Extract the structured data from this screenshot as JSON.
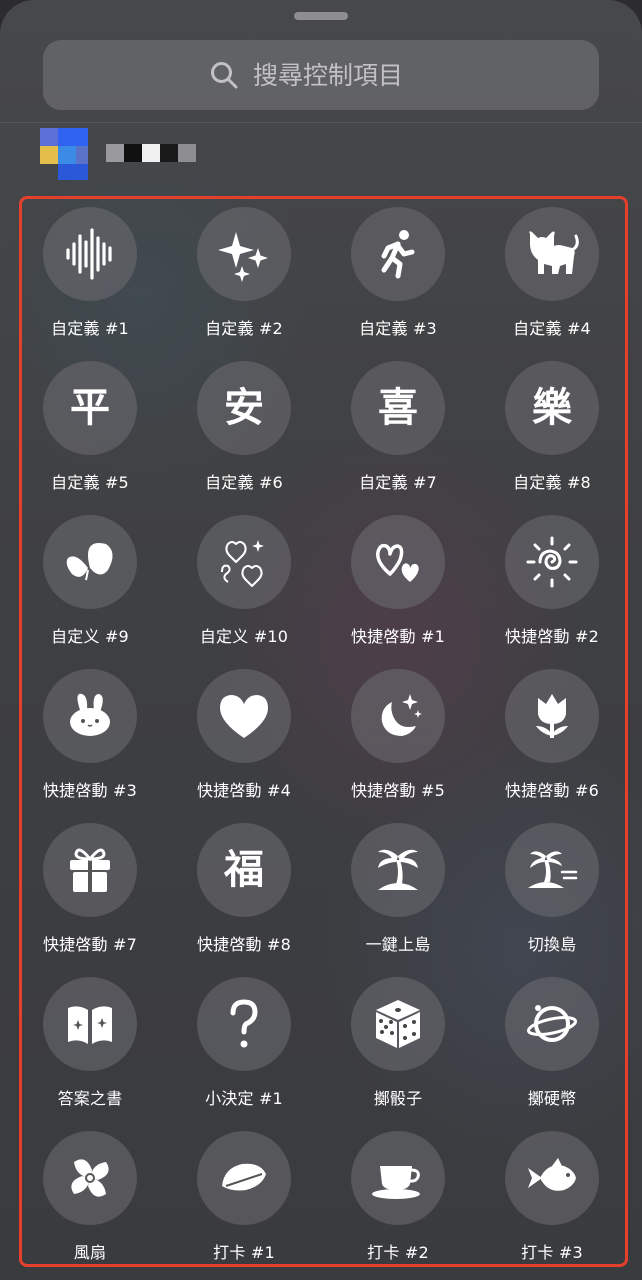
{
  "search": {
    "placeholder": "搜尋控制項目"
  },
  "controls": [
    {
      "label": "自定義 #1",
      "icon": "soundwave-icon"
    },
    {
      "label": "自定義 #2",
      "icon": "sparkles-icon"
    },
    {
      "label": "自定義 #3",
      "icon": "running-figure-icon"
    },
    {
      "label": "自定義 #4",
      "icon": "cat-icon"
    },
    {
      "label": "自定義 #5",
      "icon": "ping-character-icon",
      "glyph": "平"
    },
    {
      "label": "自定義 #6",
      "icon": "an-character-icon",
      "glyph": "安"
    },
    {
      "label": "自定義 #7",
      "icon": "xi-character-icon",
      "glyph": "喜"
    },
    {
      "label": "自定義 #8",
      "icon": "le-character-icon",
      "glyph": "樂"
    },
    {
      "label": "自定义 #9",
      "icon": "butterfly-icon"
    },
    {
      "label": "自定义 #10",
      "icon": "doodle-hearts-icon"
    },
    {
      "label": "快捷啓動 #1",
      "icon": "two-hearts-icon"
    },
    {
      "label": "快捷啓動 #2",
      "icon": "swirl-sun-icon"
    },
    {
      "label": "快捷啓動 #3",
      "icon": "bunny-icon"
    },
    {
      "label": "快捷啓動 #4",
      "icon": "heart-icon"
    },
    {
      "label": "快捷啓動 #5",
      "icon": "moon-stars-icon"
    },
    {
      "label": "快捷啓動 #6",
      "icon": "tulip-icon"
    },
    {
      "label": "快捷啓動 #7",
      "icon": "gift-icon"
    },
    {
      "label": "快捷啓動 #8",
      "icon": "fu-character-icon",
      "glyph": "福"
    },
    {
      "label": "一鍵上島",
      "icon": "island-palm-icon"
    },
    {
      "label": "切換島",
      "icon": "island-switch-icon"
    },
    {
      "label": "答案之書",
      "icon": "open-book-icon"
    },
    {
      "label": "小決定 #1",
      "icon": "question-mark-icon"
    },
    {
      "label": "擲骰子",
      "icon": "dice-icon"
    },
    {
      "label": "擲硬幣",
      "icon": "coin-orbit-icon"
    },
    {
      "label": "風扇",
      "icon": "fan-icon"
    },
    {
      "label": "打卡 #1",
      "icon": "leaf-icon"
    },
    {
      "label": "打卡 #2",
      "icon": "coffee-cup-icon"
    },
    {
      "label": "打卡 #3",
      "icon": "fish-icon"
    }
  ],
  "colors": {
    "highlight_border": "#e5402b",
    "tile_background": "#6e6e72",
    "label_text": "#ffffff"
  }
}
